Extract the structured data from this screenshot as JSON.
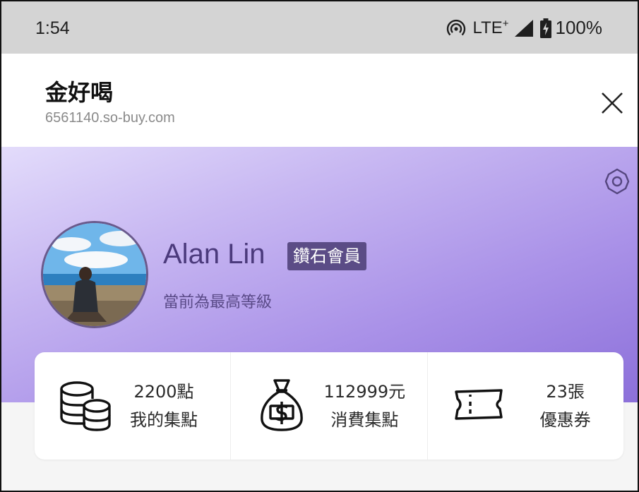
{
  "status_bar": {
    "time": "1:54",
    "network": "LTE",
    "network_sup": "+",
    "battery": "100%"
  },
  "header": {
    "title": "金好喝",
    "url": "6561140.so-buy.com"
  },
  "profile": {
    "name": "Alan Lin",
    "badge": "鑽石會員",
    "level_text": "當前為最高等級"
  },
  "stats": [
    {
      "value": "2200點",
      "label": "我的集點",
      "icon": "coins-icon"
    },
    {
      "value": "112999元",
      "label": "消費集點",
      "icon": "money-bag-icon"
    },
    {
      "value": "23張",
      "label": "優惠券",
      "icon": "coupon-icon"
    }
  ],
  "colors": {
    "status_bar_bg": "#d4d4d4",
    "banner_gradient_start": "#e3dcfb",
    "banner_gradient_end": "#8c70da",
    "badge_bg": "#5b4c86",
    "name_text": "#4b3a7c"
  }
}
